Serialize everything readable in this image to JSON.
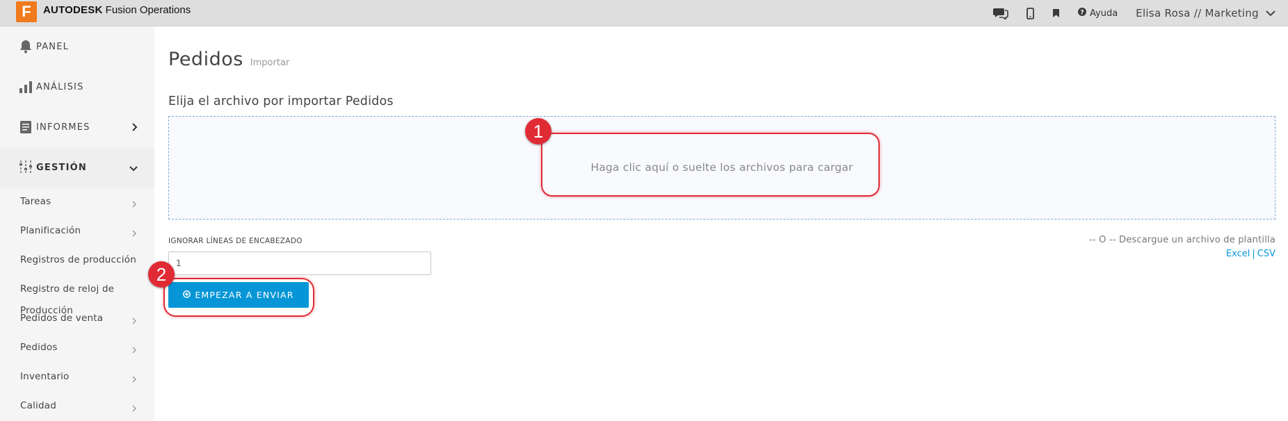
{
  "app": {
    "brand_bold": "AUTODESK",
    "brand_rest": "Fusion Operations",
    "logo_letter": "F",
    "accent_color": "#0696d7",
    "logo_color": "#f07a1c"
  },
  "topbar": {
    "icons": [
      "chat-icon",
      "mobile-icon",
      "bookmark-icon",
      "help-icon"
    ],
    "help_label": "Ayuda",
    "user_label": "Elisa Rosa // Marketing"
  },
  "sidebar": {
    "main_items": [
      {
        "label": "PANEL",
        "icon": "bell-icon"
      },
      {
        "label": "ANÁLISIS",
        "icon": "bar-chart-icon"
      },
      {
        "label": "INFORMES",
        "icon": "document-icon"
      },
      {
        "label": "GESTIÓN",
        "icon": "sliders-icon"
      }
    ],
    "sub_items": [
      {
        "label": "Tareas"
      },
      {
        "label": "Planificación"
      },
      {
        "label": "Registros de producción"
      },
      {
        "label": "Registro de reloj de"
      },
      {
        "label": "Pedidos de venta"
      },
      {
        "label": "Pedidos"
      },
      {
        "label": "Inventario"
      },
      {
        "label": "Calidad"
      }
    ],
    "overlap_text": "Producción"
  },
  "main": {
    "title": "Pedidos",
    "subtitle": "Importar",
    "section_title": "Elija el archivo por importar Pedidos",
    "dropzone_text": "Haga clic aquí o suelte los archivos para cargar",
    "header_lines_label": "IGNORAR LÍNEAS DE ENCABEZADO",
    "header_lines_value": "1",
    "start_button": "EMPEZAR A ENVIAR",
    "template_note": "-- O -- Descargue un archivo de plantilla",
    "template_excel": "Excel",
    "template_separator": "|",
    "template_csv": "CSV"
  },
  "annotations": [
    {
      "number": "1",
      "color": "#e02b35"
    },
    {
      "number": "2",
      "color": "#e02b35"
    }
  ]
}
